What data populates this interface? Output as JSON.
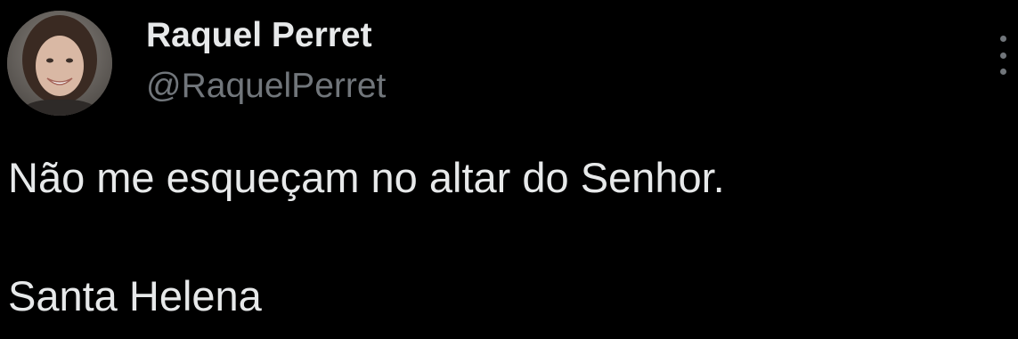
{
  "author": {
    "display_name": "Raquel Perret",
    "handle": "@RaquelPerret",
    "avatar_icon": "profile-photo"
  },
  "tweet": {
    "lines": [
      "Não me esqueçam no altar do Senhor.",
      "Santa Helena"
    ]
  },
  "actions": {
    "more_icon": "vertical-ellipsis-icon"
  },
  "colors": {
    "background": "#000000",
    "primary_text": "#e7e9ea",
    "secondary_text": "#71767b"
  }
}
